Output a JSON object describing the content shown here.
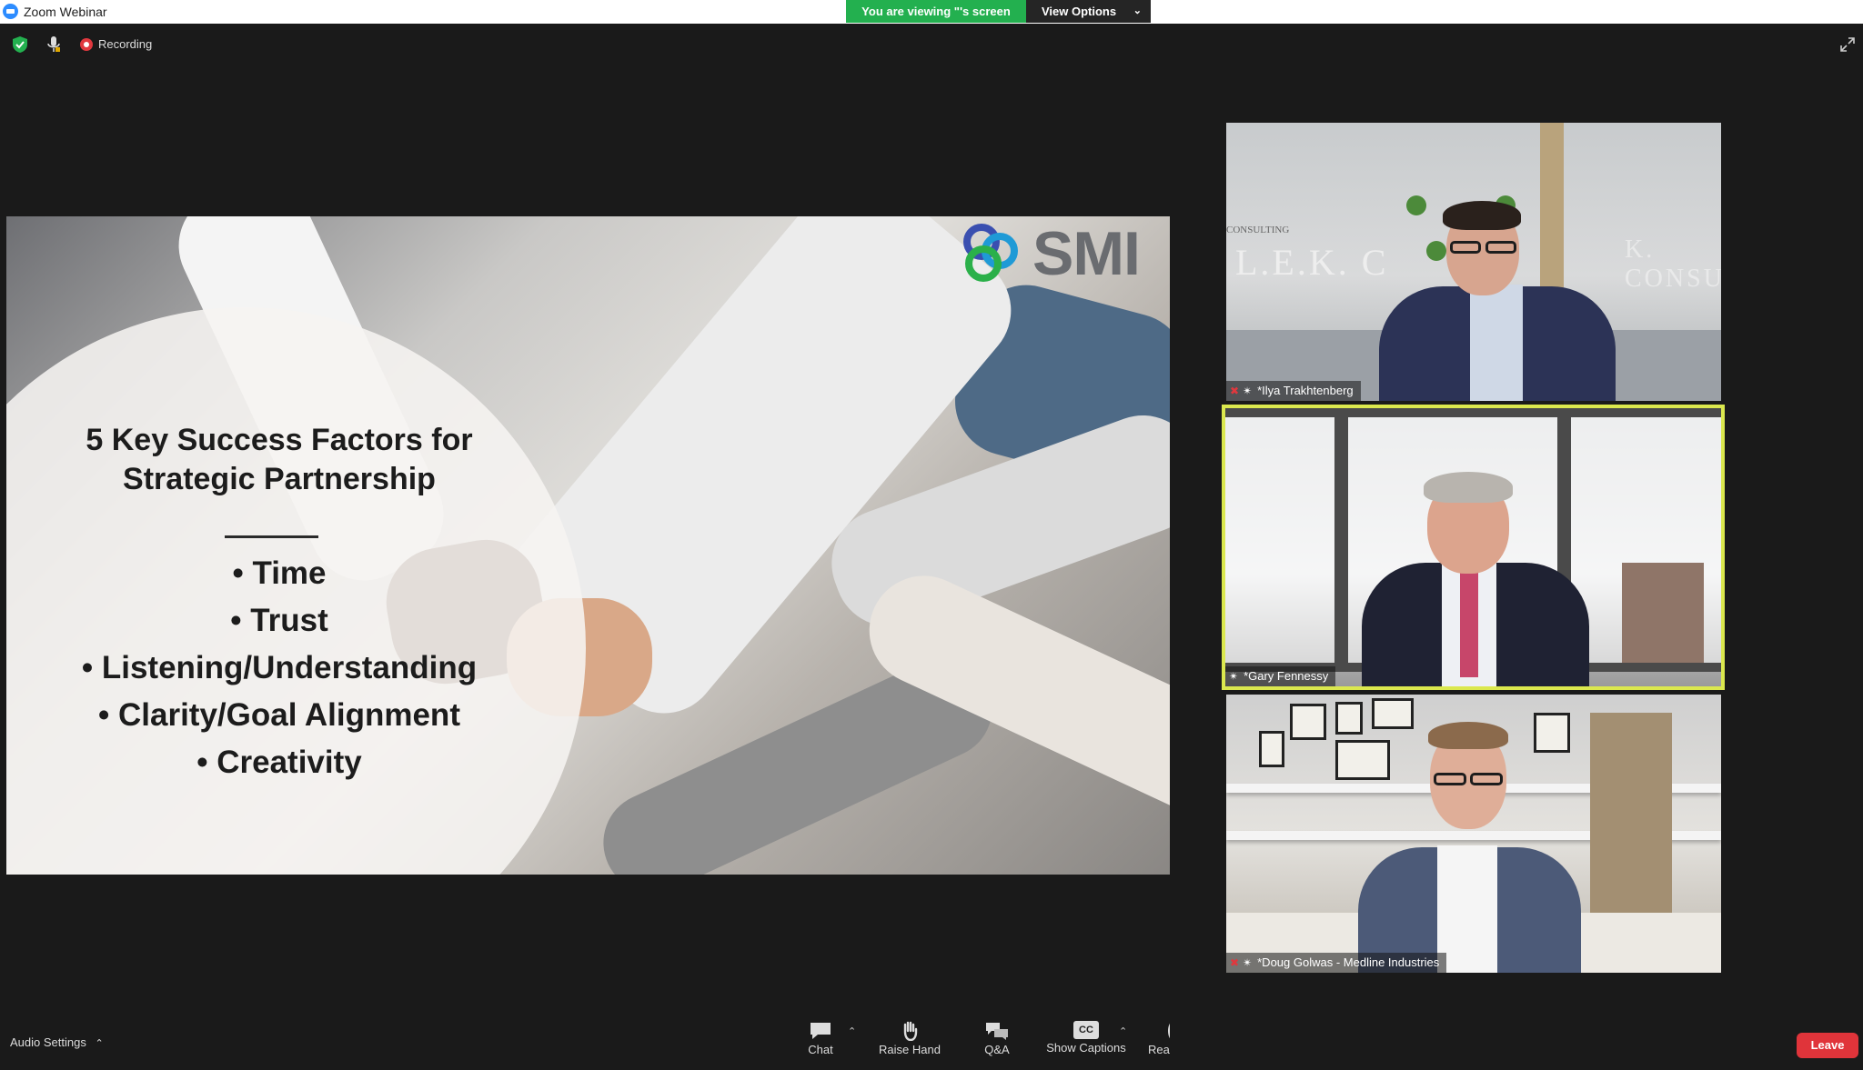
{
  "window": {
    "app_title": "Zoom Webinar",
    "viewing_banner": "You are viewing \"'s screen",
    "view_options_label": "View Options"
  },
  "top_toolbar": {
    "recording_label": "Recording"
  },
  "slide": {
    "logo_text": "SMI",
    "heading_line1": "5 Key Success Factors for",
    "heading_line2": "Strategic Partnership",
    "bullets": [
      "• Time",
      "• Trust",
      "• Listening/Understanding",
      "• Clarity/Goal Alignment",
      "• Creativity"
    ]
  },
  "participants": [
    {
      "name": "*Ilya Trakhtenberg",
      "muted": true,
      "pinned": true,
      "background_text": "L.E.K. C",
      "background_text_2": "K. CONSUL",
      "background_small": "CONSULTING"
    },
    {
      "name": "*Gary Fennessy",
      "muted": false,
      "pinned": true,
      "active_speaker": true
    },
    {
      "name": "*Doug Golwas - Medline Industries",
      "muted": true,
      "pinned": true
    }
  ],
  "bottom_toolbar": {
    "audio_settings_label": "Audio Settings",
    "chat_label": "Chat",
    "raise_hand_label": "Raise Hand",
    "qa_label": "Q&A",
    "show_captions_label": "Show Captions",
    "cc_badge": "CC",
    "reactions_label_partial": "Rea",
    "leave_label": "Leave"
  },
  "colors": {
    "banner_green": "#23b04f",
    "active_speaker_border": "#dbe84e",
    "leave_red": "#e0343a",
    "recording_red": "#e0383e"
  }
}
